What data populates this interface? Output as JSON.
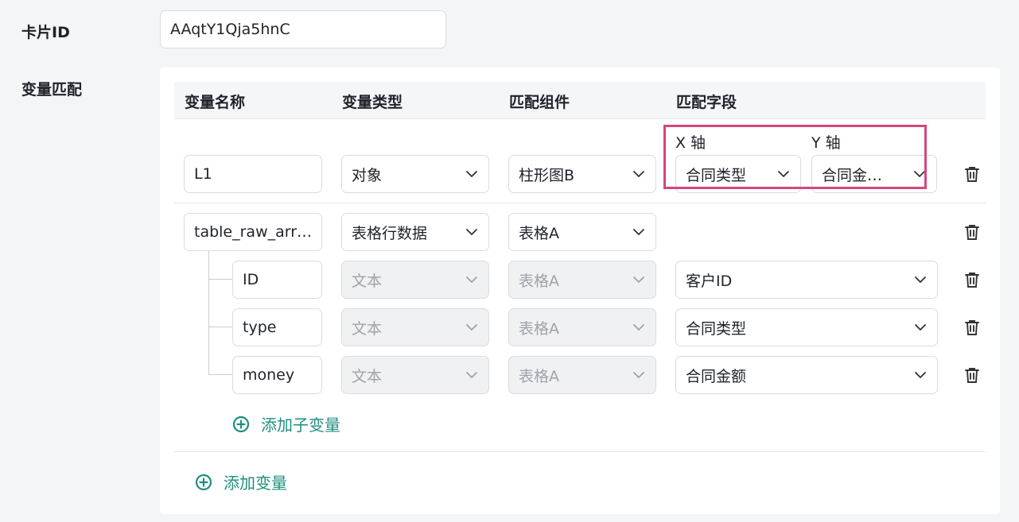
{
  "card": {
    "label": "卡片ID",
    "value": "AAqtY1Qja5hnC"
  },
  "mapping": {
    "label": "变量匹配",
    "headers": {
      "name": "变量名称",
      "type": "变量类型",
      "component": "匹配组件",
      "field": "匹配字段"
    },
    "row1": {
      "name": "L1",
      "type": "对象",
      "component": "柱形图B",
      "x_axis_label": "X 轴",
      "y_axis_label": "Y 轴",
      "x_value": "合同类型",
      "y_value": "合同金…"
    },
    "row2": {
      "name": "table_raw_arr…",
      "type": "表格行数据",
      "component": "表格A"
    },
    "children": [
      {
        "name": "ID",
        "type": "文本",
        "component": "表格A",
        "field": "客户ID"
      },
      {
        "name": "type",
        "type": "文本",
        "component": "表格A",
        "field": "合同类型"
      },
      {
        "name": "money",
        "type": "文本",
        "component": "表格A",
        "field": "合同金额"
      }
    ],
    "add_child_label": "添加子变量",
    "add_var_label": "添加变量"
  },
  "colors": {
    "accent": "#1e8e7e",
    "highlight": "#d6467f"
  },
  "icons": {
    "delete": "trash-icon",
    "add": "plus-circle-icon",
    "dropdown": "chevron-down-icon"
  }
}
